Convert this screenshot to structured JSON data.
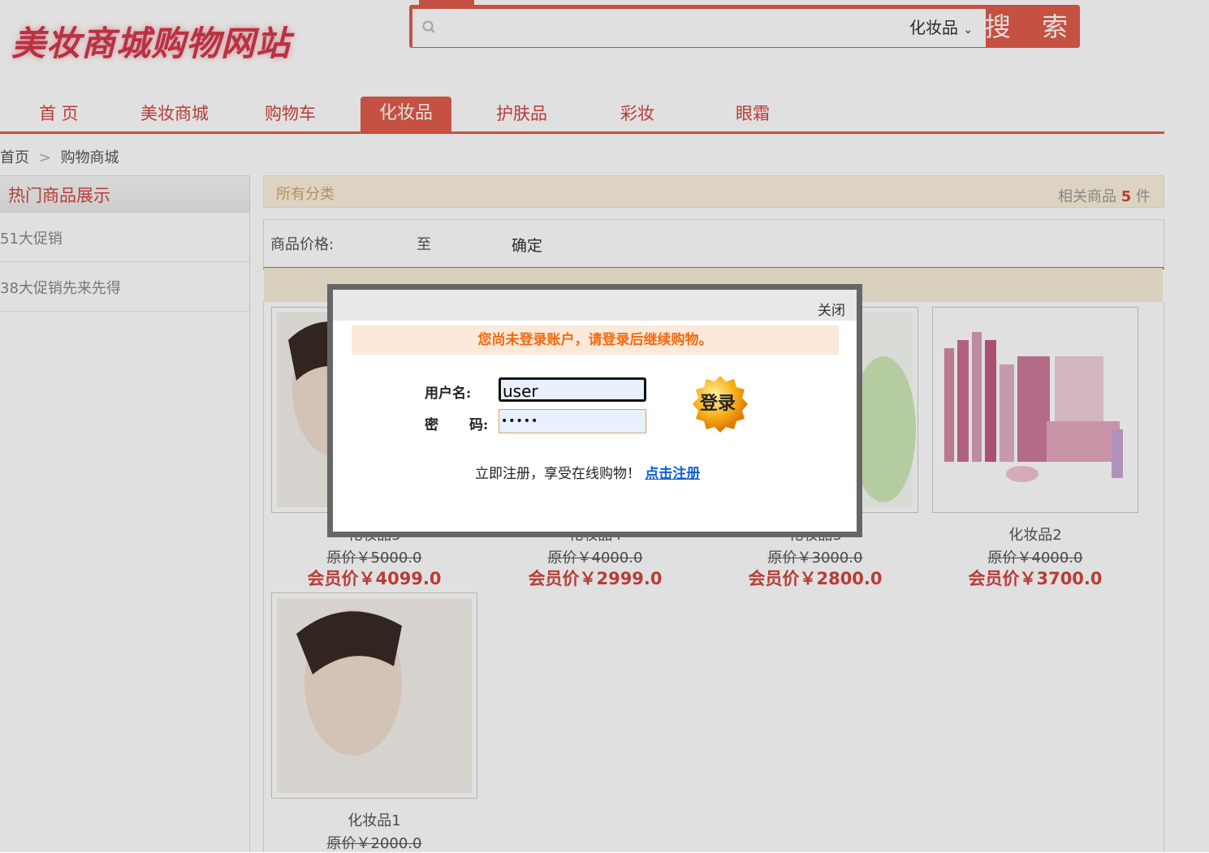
{
  "header": {
    "logo_text": "美妆商城购物网站",
    "search": {
      "placeholder": "",
      "category": "化妆品",
      "button_label": "搜 索"
    }
  },
  "nav": {
    "items": [
      "首 页",
      "美妆商城",
      "购物车",
      "化妆品",
      "护肤品",
      "彩妆",
      "眼霜"
    ],
    "active_index": 3
  },
  "breadcrumb": {
    "home": "首页",
    "separator": ">",
    "current": "购物商城"
  },
  "sidebar": {
    "title": "热门商品展示",
    "items": [
      "51大促销",
      "38大促销先来先得"
    ]
  },
  "category_bar": {
    "label": "所有分类",
    "count_prefix": "相关商品",
    "count": "5",
    "count_suffix": "件"
  },
  "filter": {
    "price_label": "商品价格:",
    "to_label": "至",
    "confirm_label": "确定"
  },
  "products": [
    {
      "name": "化妆品5",
      "orig": "原价￥5000.0",
      "vip": "会员价￥4099.0"
    },
    {
      "name": "化妆品4",
      "orig": "原价￥4000.0",
      "vip": "会员价￥2999.0"
    },
    {
      "name": "化妆品3",
      "orig": "原价￥3000.0",
      "vip": "会员价￥2800.0"
    },
    {
      "name": "化妆品2",
      "orig": "原价￥4000.0",
      "vip": "会员价￥3700.0"
    },
    {
      "name": "化妆品1",
      "orig": "原价￥2000.0",
      "vip": ""
    }
  ],
  "dialog": {
    "close_label": "关闭",
    "notice": "您尚未登录账户，请登录后继续购物。",
    "username_label": "用户名:",
    "username_value": "user",
    "password_label_1": "密",
    "password_label_2": "码:",
    "password_value": "•••••",
    "login_label": "登录",
    "register_text": "立即注册，享受在线购物！",
    "register_link": "点击注册"
  },
  "colors": {
    "accent": "#e05d4c",
    "price": "#d2453e",
    "notice": "#f26a10",
    "link": "#0b5ed7"
  }
}
